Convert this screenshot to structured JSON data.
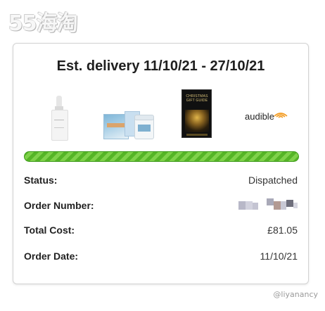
{
  "watermark": {
    "logo_text": "55海淘",
    "credit": "@liyanancy"
  },
  "card": {
    "title": "Est. delivery 11/10/21 - 27/10/21",
    "products": [
      {
        "name": "serum-bottle"
      },
      {
        "name": "skincare-kit"
      },
      {
        "name": "christmas-gift-guide-book",
        "cover_text": "CHRISTMAS GIFT GUIDE"
      },
      {
        "name": "audible",
        "label": "audible"
      }
    ],
    "progress": {
      "fraction": 1.0,
      "color": "#5bbd2a"
    },
    "details": [
      {
        "label": "Status:",
        "value": "Dispatched"
      },
      {
        "label": "Order Number:",
        "value": ""
      },
      {
        "label": "Total Cost:",
        "value": "£81.05"
      },
      {
        "label": "Order Date:",
        "value": "11/10/21"
      }
    ]
  }
}
